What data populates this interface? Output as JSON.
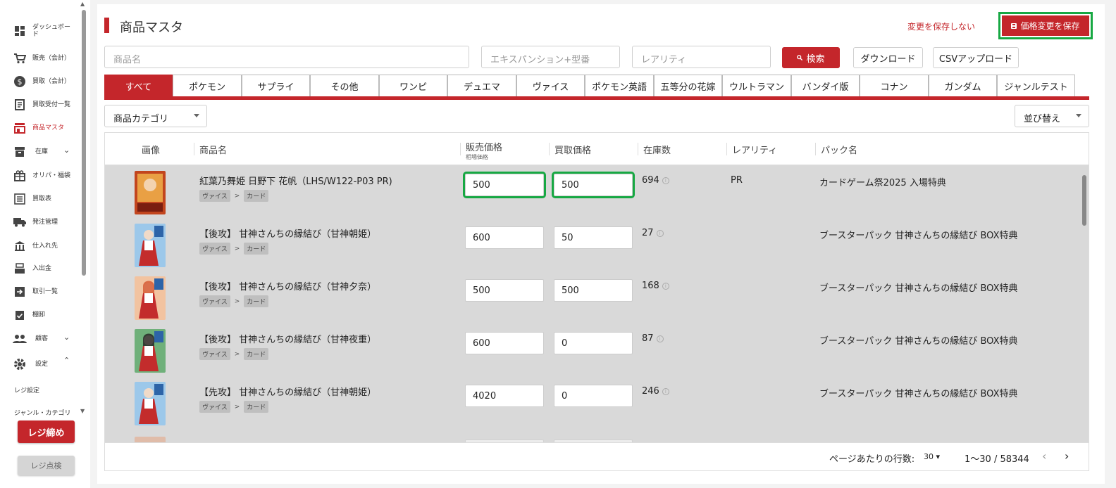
{
  "sidebar": {
    "items": [
      {
        "label": "ダッシュボード",
        "icon": "dashboard-icon"
      },
      {
        "label": "販売（会計）",
        "icon": "cart-icon"
      },
      {
        "label": "買取（会計）",
        "icon": "dollar-icon"
      },
      {
        "label": "買取受付一覧",
        "icon": "receipt-icon"
      },
      {
        "label": "商品マスタ",
        "icon": "store-icon"
      },
      {
        "label": "在庫",
        "icon": "inventory-icon"
      },
      {
        "label": "オリパ・福袋",
        "icon": "gift-icon"
      },
      {
        "label": "買取表",
        "icon": "list-icon"
      },
      {
        "label": "発注管理",
        "icon": "truck-icon"
      },
      {
        "label": "仕入れ先",
        "icon": "bank-icon"
      },
      {
        "label": "入出金",
        "icon": "register-icon"
      },
      {
        "label": "取引一覧",
        "icon": "login-icon"
      },
      {
        "label": "棚卸",
        "icon": "clipboard-icon"
      },
      {
        "label": "顧客",
        "icon": "people-icon"
      },
      {
        "label": "設定",
        "icon": "gear-icon"
      }
    ],
    "sub_items": [
      "レジ設定",
      "ジャンル・カテゴリ"
    ],
    "register_close": "レジ締め",
    "register_check": "レジ点検"
  },
  "header": {
    "title": "商品マスタ",
    "discard_label": "変更を保存しない",
    "save_label": "価格変更を保存"
  },
  "search": {
    "name_placeholder": "商品名",
    "expansion_placeholder": "エキスパンション+型番",
    "rarity_placeholder": "レアリティ",
    "search_label": "検索",
    "download_label": "ダウンロード",
    "csv_upload_label": "CSVアップロード"
  },
  "tabs": [
    "すべて",
    "ポケモン",
    "サプライ",
    "その他",
    "ワンピ",
    "デュエマ",
    "ヴァイス",
    "ポケモン英語",
    "五等分の花嫁",
    "ウルトラマン",
    "バンダイ版",
    "コナン",
    "ガンダム",
    "ジャンルテスト"
  ],
  "filters": {
    "category": "商品カテゴリ",
    "sort": "並び替え"
  },
  "table": {
    "headers": {
      "image": "画像",
      "name": "商品名",
      "sale_price": "販売価格",
      "sale_price_sub": "相場価格",
      "buy_price": "買取価格",
      "stock": "在庫数",
      "rarity": "レアリティ",
      "pack": "パック名"
    },
    "rows": [
      {
        "name": "紅葉乃舞姫 日野下 花帆（LHS/W122-P03 PR)",
        "genre": "ヴァイス",
        "category": "カード",
        "sale_price": "500",
        "buy_price": "500",
        "stock": "694",
        "rarity": "PR",
        "pack": "カードゲーム祭2025 入場特典",
        "card_color": "#c2451e"
      },
      {
        "name": "【後攻】 甘神さんちの縁結び（甘神朝姫）",
        "genre": "ヴァイス",
        "category": "カード",
        "sale_price": "600",
        "buy_price": "50",
        "stock": "27",
        "rarity": "",
        "pack": "ブースターパック 甘神さんちの縁結び BOX特典",
        "card_color": "#3d86c6"
      },
      {
        "name": "【後攻】 甘神さんちの縁結び（甘神夕奈）",
        "genre": "ヴァイス",
        "category": "カード",
        "sale_price": "500",
        "buy_price": "500",
        "stock": "168",
        "rarity": "",
        "pack": "ブースターパック 甘神さんちの縁結び BOX特典",
        "card_color": "#e07a4a"
      },
      {
        "name": "【後攻】 甘神さんちの縁結び（甘神夜重）",
        "genre": "ヴァイス",
        "category": "カード",
        "sale_price": "600",
        "buy_price": "0",
        "stock": "87",
        "rarity": "",
        "pack": "ブースターパック 甘神さんちの縁結び BOX特典",
        "card_color": "#4a9a55"
      },
      {
        "name": "【先攻】 甘神さんちの縁結び（甘神朝姫）",
        "genre": "ヴァイス",
        "category": "カード",
        "sale_price": "4020",
        "buy_price": "0",
        "stock": "246",
        "rarity": "",
        "pack": "ブースターパック 甘神さんちの縁結び BOX特典",
        "card_color": "#3d86c6"
      }
    ]
  },
  "footer": {
    "rows_per_page_label": "ページあたりの行数:",
    "rows_per_page": "30",
    "range": "1〜30 / 58344"
  },
  "colors": {
    "accent": "#c4262b",
    "highlight": "#17a843"
  }
}
